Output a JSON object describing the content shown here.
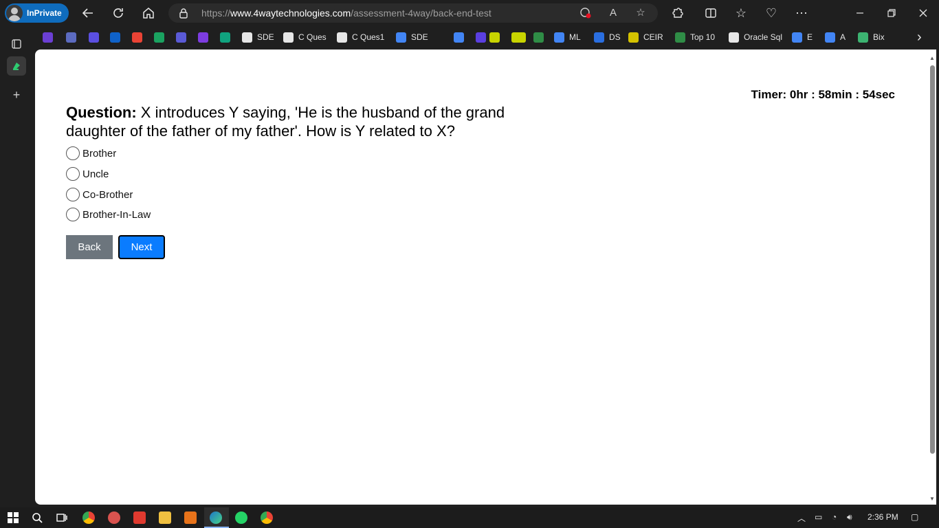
{
  "browser": {
    "profile_label": "InPrivate",
    "url_prefix": "https://",
    "url_domain": "www.4waytechnologies.com",
    "url_path": "/assessment-4way/back-end-test"
  },
  "bookmarks": [
    {
      "label": "",
      "color": "#6b3fd4"
    },
    {
      "label": "",
      "color": "#5c6bc0"
    },
    {
      "label": "",
      "color": "#5b4fe0"
    },
    {
      "label": "",
      "color": "#0f62c9"
    },
    {
      "label": "",
      "color": "#ea4335"
    },
    {
      "label": "",
      "color": "#1aa260"
    },
    {
      "label": "",
      "color": "#5a5ad6"
    },
    {
      "label": "",
      "color": "#7d3ce0"
    },
    {
      "label": "",
      "color": "#10a37f"
    },
    {
      "label": "SDE",
      "color": "#e6e6e6"
    },
    {
      "label": "C Ques",
      "color": "#e6e6e6"
    },
    {
      "label": "C Ques1",
      "color": "#e6e6e6"
    },
    {
      "label": "SDE",
      "color": "#4285f4"
    },
    {
      "label": "",
      "color": "#4285f4"
    },
    {
      "label": "",
      "color": "#c8d400"
    },
    {
      "label": "",
      "color": "#5a3fe0"
    },
    {
      "label": "",
      "color": "#c8d400"
    },
    {
      "label": "",
      "color": "#2f8d46"
    },
    {
      "label": "",
      "color": "#c8d400"
    },
    {
      "label": "ML",
      "color": "#4285f4"
    },
    {
      "label": "DS",
      "color": "#2a6ee0"
    },
    {
      "label": "CEIR",
      "color": "#d4c200"
    },
    {
      "label": "Top 10",
      "color": "#2f8d46"
    },
    {
      "label": "Oracle Sql",
      "color": "#e6e6e6"
    },
    {
      "label": "E",
      "color": "#4285f4"
    },
    {
      "label": "A",
      "color": "#4285f4"
    },
    {
      "label": "Bix",
      "color": "#3cb371"
    }
  ],
  "page": {
    "timer": "Timer: 0hr : 58min : 54sec",
    "question_label": "Question:",
    "question_text": " X introduces Y saying, 'He is the husband of the grand daughter of the father of my father'. How is Y related to X?",
    "options": [
      "Brother",
      "Uncle",
      "Co-Brother",
      "Brother-In-Law"
    ],
    "back_label": "Back",
    "next_label": "Next"
  },
  "taskbar": {
    "time": "2:36 PM"
  }
}
